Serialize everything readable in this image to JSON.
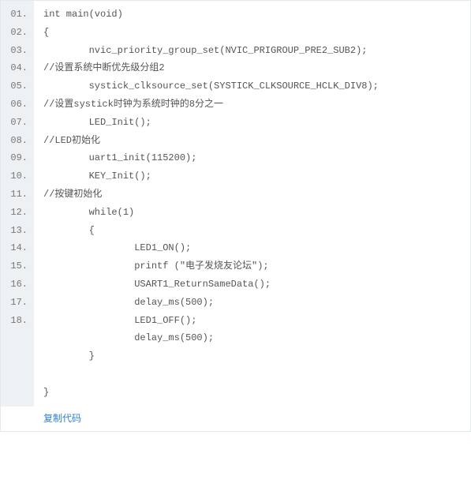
{
  "code": {
    "lines": [
      {
        "num": "01.",
        "text": "int main(void)"
      },
      {
        "num": "02.",
        "text": "{"
      },
      {
        "num": "03.",
        "text": "        nvic_priority_group_set(NVIC_PRIGROUP_PRE2_SUB2);                                    //设置系统中断优先级分组2"
      },
      {
        "num": "04.",
        "text": "        systick_clksource_set(SYSTICK_CLKSOURCE_HCLK_DIV8);                        //设置systick时钟为系统时钟的8分之一"
      },
      {
        "num": "05.",
        "text": "        LED_Init();                                                                                                                     //LED初始化"
      },
      {
        "num": "06.",
        "text": "        uart1_init(115200);"
      },
      {
        "num": "07.",
        "text": "        KEY_Init();                                                                                                                     //按键初始化"
      },
      {
        "num": "08.",
        "text": "        while(1)"
      },
      {
        "num": "09.",
        "text": "        {"
      },
      {
        "num": "10.",
        "text": "                LED1_ON();"
      },
      {
        "num": "11.",
        "text": "                printf (\"电子发烧友论坛\");"
      },
      {
        "num": "12.",
        "text": "                USART1_ReturnSameData();"
      },
      {
        "num": "13.",
        "text": "                delay_ms(500);"
      },
      {
        "num": "14.",
        "text": "                LED1_OFF();"
      },
      {
        "num": "15.",
        "text": "                delay_ms(500);"
      },
      {
        "num": "16.",
        "text": "        }"
      },
      {
        "num": "17.",
        "text": ""
      },
      {
        "num": "18.",
        "text": "}"
      }
    ]
  },
  "footer": {
    "copy_label": "复制代码"
  }
}
